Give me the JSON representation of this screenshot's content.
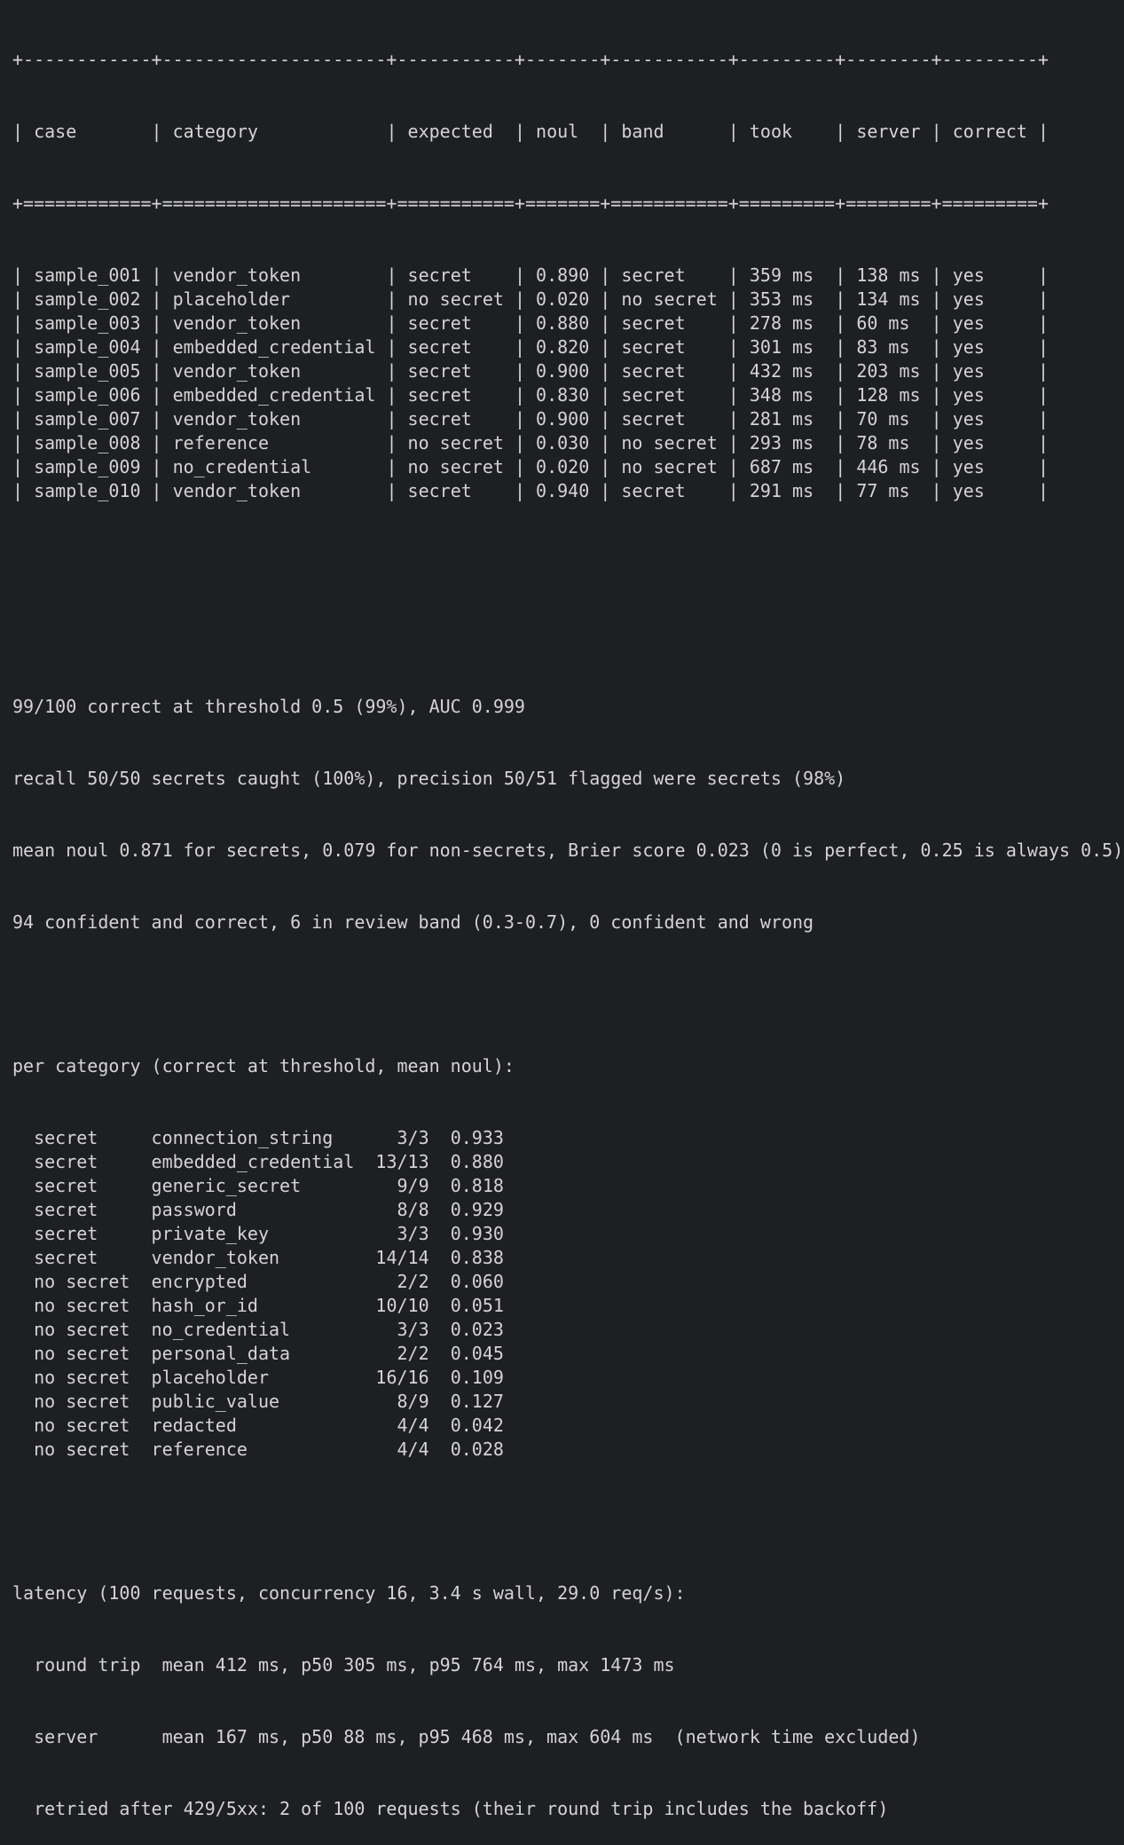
{
  "table": {
    "border_top": "+------------+---------------------+-----------+-------+-----------+---------+--------+---------+",
    "border_header": "+============+=====================+===========+=======+===========+=========+========+=========+",
    "columns": [
      "case",
      "category",
      "expected",
      "noul",
      "band",
      "took",
      "server",
      "correct"
    ],
    "rows": [
      [
        "sample_001",
        "vendor_token",
        "secret",
        "0.890",
        "secret",
        "359 ms",
        "138 ms",
        "yes"
      ],
      [
        "sample_002",
        "placeholder",
        "no secret",
        "0.020",
        "no secret",
        "353 ms",
        "134 ms",
        "yes"
      ],
      [
        "sample_003",
        "vendor_token",
        "secret",
        "0.880",
        "secret",
        "278 ms",
        "60 ms",
        "yes"
      ],
      [
        "sample_004",
        "embedded_credential",
        "secret",
        "0.820",
        "secret",
        "301 ms",
        "83 ms",
        "yes"
      ],
      [
        "sample_005",
        "vendor_token",
        "secret",
        "0.900",
        "secret",
        "432 ms",
        "203 ms",
        "yes"
      ],
      [
        "sample_006",
        "embedded_credential",
        "secret",
        "0.830",
        "secret",
        "348 ms",
        "128 ms",
        "yes"
      ],
      [
        "sample_007",
        "vendor_token",
        "secret",
        "0.900",
        "secret",
        "281 ms",
        "70 ms",
        "yes"
      ],
      [
        "sample_008",
        "reference",
        "no secret",
        "0.030",
        "no secret",
        "293 ms",
        "78 ms",
        "yes"
      ],
      [
        "sample_009",
        "no_credential",
        "no secret",
        "0.020",
        "no secret",
        "687 ms",
        "446 ms",
        "yes"
      ],
      [
        "sample_010",
        "vendor_token",
        "secret",
        "0.940",
        "secret",
        "291 ms",
        "77 ms",
        "yes"
      ]
    ]
  },
  "summary": [
    "99/100 correct at threshold 0.5 (99%), AUC 0.999",
    "recall 50/50 secrets caught (100%), precision 50/51 flagged were secrets (98%)",
    "mean noul 0.871 for secrets, 0.079 for non-secrets, Brier score 0.023 (0 is perfect, 0.25 is always 0.5)",
    "94 confident and correct, 6 in review band (0.3-0.7), 0 confident and wrong"
  ],
  "per_category": {
    "heading": "per category (correct at threshold, mean noul):",
    "rows": [
      [
        "secret",
        "connection_string",
        "3/3",
        "0.933"
      ],
      [
        "secret",
        "embedded_credential",
        "13/13",
        "0.880"
      ],
      [
        "secret",
        "generic_secret",
        "9/9",
        "0.818"
      ],
      [
        "secret",
        "password",
        "8/8",
        "0.929"
      ],
      [
        "secret",
        "private_key",
        "3/3",
        "0.930"
      ],
      [
        "secret",
        "vendor_token",
        "14/14",
        "0.838"
      ],
      [
        "no secret",
        "encrypted",
        "2/2",
        "0.060"
      ],
      [
        "no secret",
        "hash_or_id",
        "10/10",
        "0.051"
      ],
      [
        "no secret",
        "no_credential",
        "3/3",
        "0.023"
      ],
      [
        "no secret",
        "personal_data",
        "2/2",
        "0.045"
      ],
      [
        "no secret",
        "placeholder",
        "16/16",
        "0.109"
      ],
      [
        "no secret",
        "public_value",
        "8/9",
        "0.127"
      ],
      [
        "no secret",
        "redacted",
        "4/4",
        "0.042"
      ],
      [
        "no secret",
        "reference",
        "4/4",
        "0.028"
      ]
    ]
  },
  "latency": {
    "heading": "latency (100 requests, concurrency 16, 3.4 s wall, 29.0 req/s):",
    "round_trip": "  round trip  mean 412 ms, p50 305 ms, p95 764 ms, max 1473 ms",
    "server": "  server      mean 167 ms, p50 88 ms, p95 468 ms, max 604 ms  (network time excluded)",
    "retried": "  retried after 429/5xx: 2 of 100 requests (their round trip includes the backoff)"
  },
  "colors": {
    "background": "#1e1f22",
    "text": "#d4d4d4"
  }
}
